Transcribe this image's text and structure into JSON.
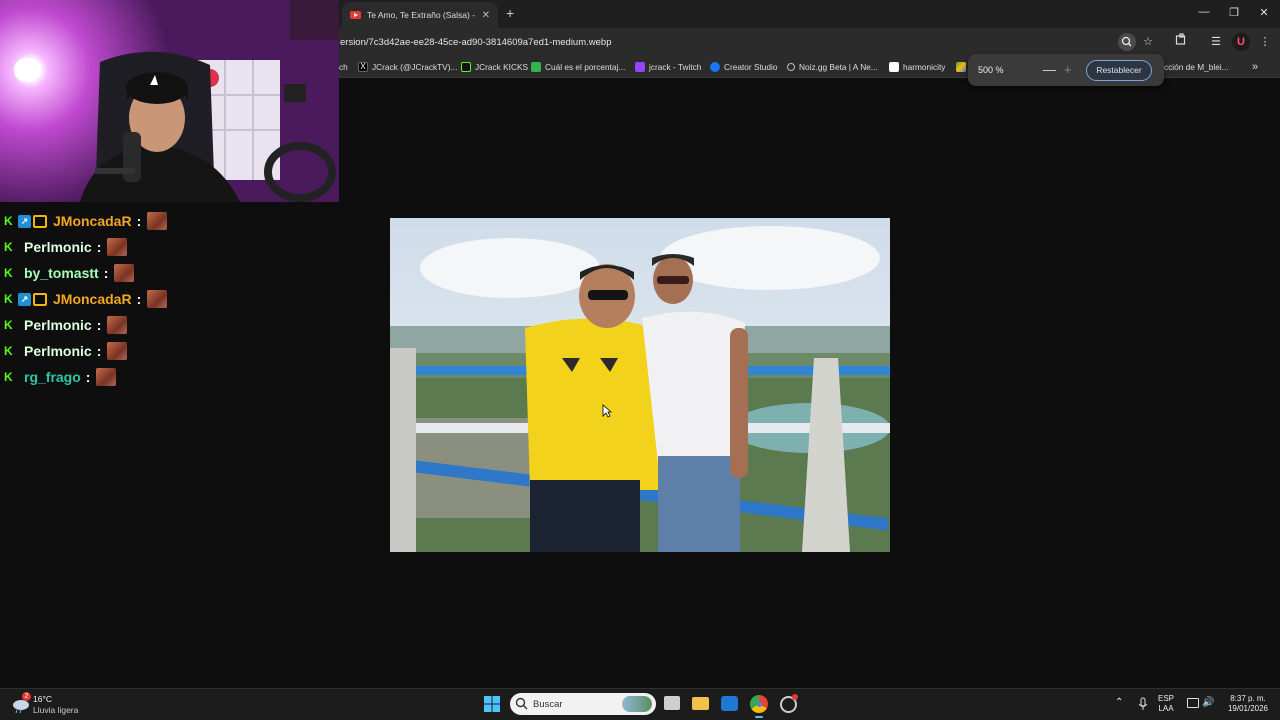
{
  "browser": {
    "tab_title": "Te Amo, Te Extraño (Salsa) - You",
    "new_tab": "+",
    "tab_close": "✕",
    "url": "ersion/7c3d42ae-ee28-45ce-ad90-3814609a7ed1-medium.webp",
    "bookmarks": [
      {
        "label": "ch",
        "color": "#9146ff"
      },
      {
        "label": "JCrack (@JCrackTV)...",
        "color": "#000000"
      },
      {
        "label": "JCrack KICKS",
        "color": "#53fc18"
      },
      {
        "label": "Cuál es el porcentaj...",
        "color": "#2fb44e"
      },
      {
        "label": "jcrack - Twitch",
        "color": "#9146ff"
      },
      {
        "label": "Creator Studio",
        "color": "#1877f2"
      },
      {
        "label": "Noiz.gg Beta | A Ne...",
        "color": "#bbbbbb"
      },
      {
        "label": "harmonicity",
        "color": "#ffffff"
      },
      {
        "label": "cción de M_blei...",
        "color": "#e0e0e0"
      }
    ],
    "bookmarks_more": "»",
    "zoom": {
      "value": "500 %",
      "minus": "—",
      "plus": "+",
      "reset_label": "Restablecer"
    },
    "window_controls": {
      "minimize": "—",
      "restore": "❐",
      "close": "✕"
    }
  },
  "chat": {
    "messages": [
      {
        "user": "JMoncadaR",
        "color": "#f5a623",
        "badges": [
          "kick",
          "verified",
          "crown"
        ]
      },
      {
        "user": "Perlmonic",
        "color": "#dfffe0",
        "badges": [
          "kick"
        ]
      },
      {
        "user": "by_tomastt",
        "color": "#a7ffb5",
        "badges": [
          "kick"
        ]
      },
      {
        "user": "JMoncadaR",
        "color": "#f5a623",
        "badges": [
          "kick",
          "verified",
          "crown"
        ]
      },
      {
        "user": "Perlmonic",
        "color": "#dfffe0",
        "badges": [
          "kick"
        ]
      },
      {
        "user": "Perlmonic",
        "color": "#dfffe0",
        "badges": [
          "kick"
        ]
      },
      {
        "user": "rg_frago",
        "color": "#2ec6a6",
        "badges": [
          "kick"
        ]
      }
    ],
    "separator": ":"
  },
  "taskbar": {
    "weather": {
      "badge": "2",
      "temp": "16°C",
      "desc": "Lluvia ligera"
    },
    "search_placeholder": "Buscar",
    "language": {
      "top": "ESP",
      "bottom": "LAA"
    },
    "time": "8:37 p. m.",
    "date": "19/01/2026"
  },
  "colors": {
    "accent": "#7aa7d9",
    "kick_green": "#53fc18",
    "yellow_shirt": "#f2d21a"
  }
}
